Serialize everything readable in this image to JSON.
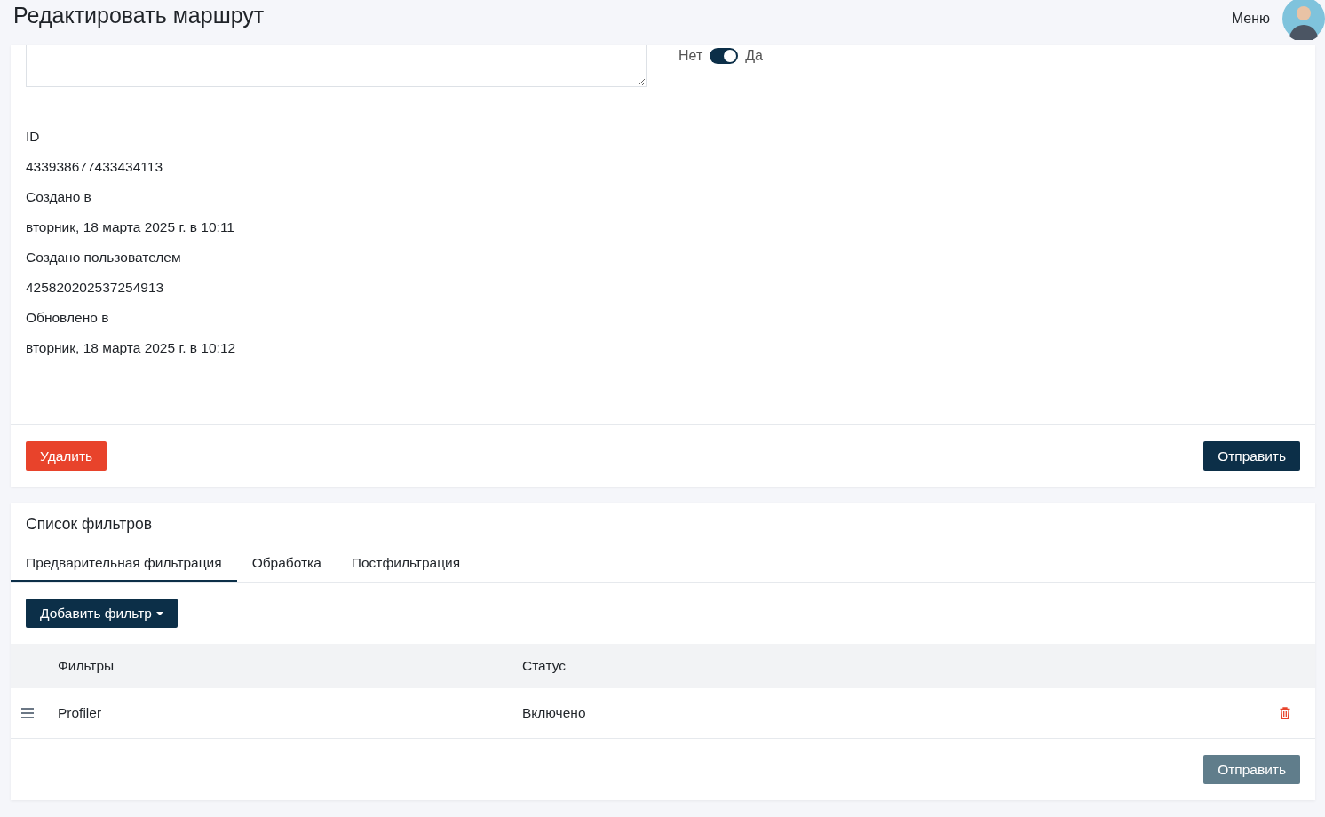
{
  "header": {
    "title": "Редактировать маршрут",
    "menu_label": "Меню"
  },
  "route_card": {
    "toggle": {
      "off_label": "Нет",
      "on_label": "Да",
      "on": true
    },
    "fields": [
      {
        "label": "ID",
        "value": "433938677433434113"
      },
      {
        "label": "Создано в",
        "value": "вторник, 18 марта 2025 г. в 10:11"
      },
      {
        "label": "Создано пользователем",
        "value": "425820202537254913"
      },
      {
        "label": "Обновлено в",
        "value": "вторник, 18 марта 2025 г. в 10:12"
      }
    ],
    "delete_button": "Удалить",
    "submit_button": {
      "label": "Отправить",
      "disabled": false
    }
  },
  "filters_card": {
    "title": "Список фильтров",
    "tabs": [
      {
        "label": "Предварительная фильтрация",
        "selected": true
      },
      {
        "label": "Обработка",
        "selected": false
      },
      {
        "label": "Постфильтрация",
        "selected": false
      }
    ],
    "add_button": "Добавить фильтр",
    "table": {
      "columns": [
        "Фильтры",
        "Статус"
      ],
      "rows": [
        {
          "filter": "Profiler",
          "status": "Включено"
        }
      ]
    },
    "submit_button": {
      "label": "Отправить",
      "disabled": true
    }
  }
}
